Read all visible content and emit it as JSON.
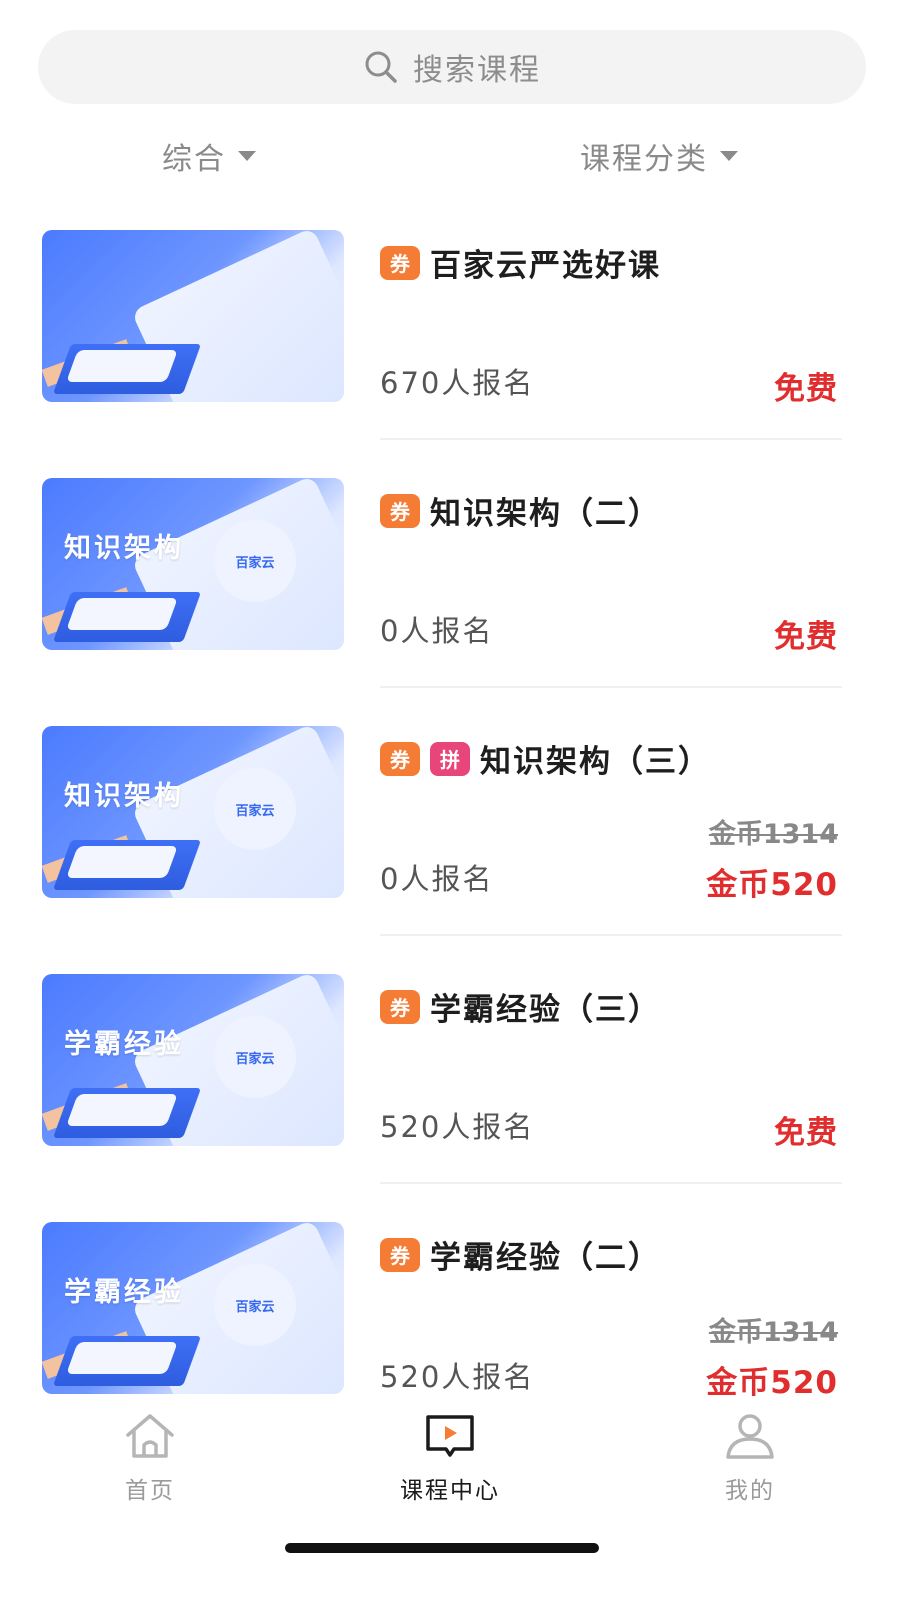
{
  "search": {
    "placeholder": "搜索课程",
    "icon": "search-icon"
  },
  "filters": [
    {
      "label": "综合"
    },
    {
      "label": "课程分类"
    }
  ],
  "courses": [
    {
      "thumb_title": "",
      "logo": "",
      "tags": [
        "券"
      ],
      "title": "百家云严选好课",
      "enrolled": "670人报名",
      "original_price": "",
      "price": "免费"
    },
    {
      "thumb_title": "知识架构",
      "logo": "百家云",
      "tags": [
        "券"
      ],
      "title": "知识架构（二）",
      "enrolled": "0人报名",
      "original_price": "",
      "price": "免费"
    },
    {
      "thumb_title": "知识架构",
      "logo": "百家云",
      "tags": [
        "券",
        "拼"
      ],
      "title": "知识架构（三）",
      "enrolled": "0人报名",
      "original_price": "金币1314",
      "price": "金币520"
    },
    {
      "thumb_title": "学霸经验",
      "logo": "百家云",
      "tags": [
        "券"
      ],
      "title": "学霸经验（三）",
      "enrolled": "520人报名",
      "original_price": "",
      "price": "免费"
    },
    {
      "thumb_title": "学霸经验",
      "logo": "百家云",
      "tags": [
        "券"
      ],
      "title": "学霸经验（二）",
      "enrolled": "520人报名",
      "original_price": "金币1314",
      "price": "金币520"
    }
  ],
  "tabbar": [
    {
      "label": "首页",
      "icon": "home-icon"
    },
    {
      "label": "课程中心",
      "icon": "course-center-icon",
      "active": true
    },
    {
      "label": "我的",
      "icon": "profile-icon"
    }
  ],
  "colors": {
    "price_red": "#e02d2d",
    "coupon_orange": "#f47c34",
    "group_pink": "#e8457a",
    "thumb_blue": "#4b7bff"
  }
}
